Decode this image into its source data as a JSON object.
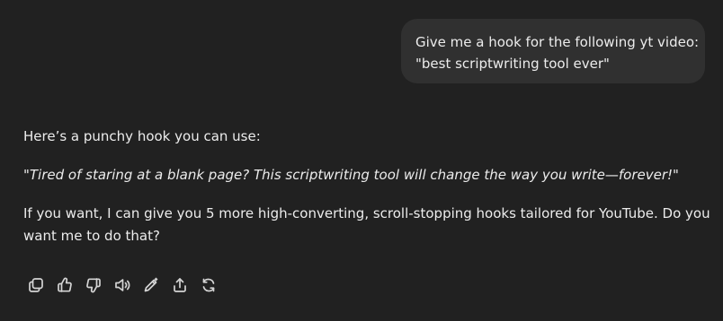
{
  "user_message": {
    "lines": [
      "Give me a hook for the following yt video:",
      "\"best scriptwriting tool ever\""
    ]
  },
  "assistant_message": {
    "intro": "Here’s a punchy hook you can use:",
    "hook": "\"Tired of staring at a blank page? This scriptwriting tool will change the way you write—forever!\"",
    "followup": "If you want, I can give you 5 more high-converting, scroll-stopping hooks tailored for YouTube. Do you want me to do that?"
  },
  "action_bar": {
    "icons": [
      "copy-icon",
      "thumbs-up-icon",
      "thumbs-down-icon",
      "read-aloud-icon",
      "edit-icon",
      "share-icon",
      "regenerate-icon"
    ]
  }
}
